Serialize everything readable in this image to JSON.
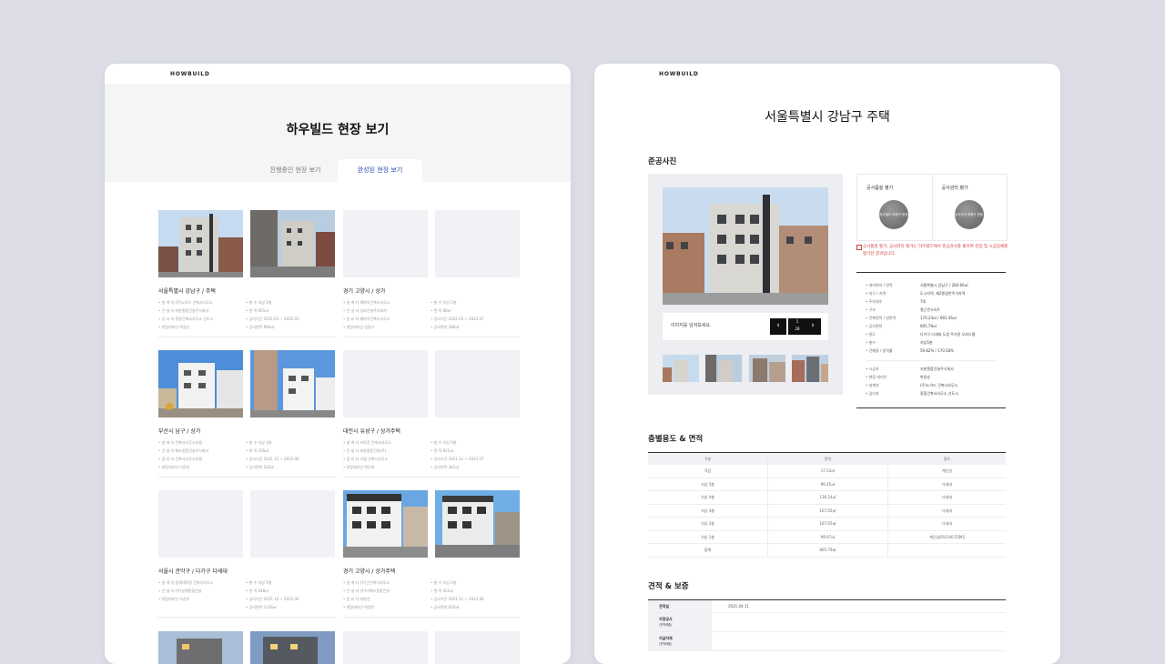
{
  "left": {
    "logo": "HOWBUILD",
    "title": "하우빌드 현장 보기",
    "tabs": [
      {
        "label": "진행중인 현장 보기",
        "active": false
      },
      {
        "label": "완성된 현장 보기",
        "active": true
      }
    ],
    "cards": [
      {
        "title": "서울특별시 강남구 / 주택",
        "rows": [
          "• 설 계 자  (주)노아드 건축사사무소",
          "• 건 설 사  지한종합건설주식회사",
          "• 공 사 자  종합건축사사무소 선도시",
          "• 현장대리인  박용순",
          "• 층    수  지상 5층",
          "• 면    적  665㎡",
          "• 공사기간  2021.03 ~ 2022.03",
          "• 공사면적  896㎡"
        ]
      },
      {
        "title": "경기 고양시 / 상가",
        "rows": [
          "• 설 계 자  해마이건축사사무소",
          "• 건 설 사  성보건설주식회사",
          "• 감 리 자  해마이건축사사무소",
          "• 현장대리인  김창규",
          "• 층    수  지상 5층",
          "• 면    적  88㎡",
          "• 공사기간  2022.03 ~ 2022.07",
          "• 공사면적  286㎡"
        ]
      },
      {
        "title": "부산시 남구 / 상가",
        "rows": [
          "• 설 계 자  건축사사무소유엠",
          "• 건 설 사  해조종합건설주식회사",
          "• 감 리 자  건축사사무소유엠",
          "• 현장대리인  이운호",
          "• 층    수  지상 3층",
          "• 면    적  205㎡",
          "• 공사기간  2021.12 ~ 2022.06",
          "• 공사면적  220㎡"
        ]
      },
      {
        "title": "대전시 유성구 / 상가주택",
        "rows": [
          "• 설 계 자  하로건 건축사사무소",
          "• 건 설 사  세한종합건설(주)",
          "• 감 리 자  디엠 건축사사무소",
          "• 현장대리인  박진희",
          "• 층    수  지상 5층",
          "• 면    적  821㎡",
          "• 공사기간  2021.11 ~ 2022.07",
          "• 공사면적  381㎡"
        ]
      },
      {
        "title": "서울시 관악구 / 다가구 다세대",
        "rows": [
          "• 설 계 자  동해대학원 건축사사무소",
          "• 건 설 사  (주)일해종합건설",
          "• 현장대리인  차성우",
          "• 층    수  지상 5층",
          "• 면    적  448㎡",
          "• 공사기간  2021.10 ~ 2022.06",
          "• 공사면적  1136㎡"
        ]
      },
      {
        "title": "경기 고양시 / 상가주택",
        "rows": [
          "• 설 계 자  (주)근건축사사무소",
          "• 건 설 사  (주)이메스종합건설",
          "• 감 리 자  대원건",
          "• 현장대리인  박정빈",
          "• 층    수  지상 5층",
          "• 면    적  351㎡",
          "• 공사기간  2021.11 ~ 2022.06",
          "• 공사면적  820㎡"
        ]
      }
    ]
  },
  "right": {
    "logo": "HOWBUILD",
    "title": "서울특별시 강남구 주택",
    "photo_section": "준공사진",
    "photo_hint": "이미지를 넘겨보세요.",
    "pager": {
      "current": "1",
      "total": "28"
    },
    "eval": [
      {
        "label": "공사품질 평가",
        "badge": "하우빌드 미평가 현장"
      },
      {
        "label": "공사관리 평가",
        "badge": "공사관리 미평가 현장"
      }
    ],
    "notice": "공사품질 평가, 공사관리 평가는 하우빌드에서 준공검사를 통하여 현장 및 시공업체를 평가한 결과입니다.",
    "spec_top": [
      [
        "• 대지위치 / 면적",
        "서울특별시 강남구 / 284.60㎡"
      ],
      [
        "• 지구 / 지역",
        "도시지역, 제2종일반주거지역"
      ],
      [
        "• 주차대수",
        "7대"
      ],
      [
        "• 구조",
        "철근콘크리트"
      ],
      [
        "• 건축면적 / 연면적",
        "170.24㎡ / 665.46㎡"
      ],
      [
        "• 공사면적",
        "665.79㎡"
      ],
      [
        "• 용도",
        "다가구 다세대 도생 주거용 오피스텔"
      ],
      [
        "• 층수",
        "지상5층"
      ],
      [
        "• 건폐율 / 용적률",
        "59.82% / 170.58%"
      ]
    ],
    "spec_bottom": [
      [
        "• 시공자",
        "지한종합건설주식회사"
      ],
      [
        "• 현장 대리인",
        "박용순"
      ],
      [
        "• 설계자",
        "(주)노아드 건축사사무소"
      ],
      [
        "• 감리자",
        "종합건축사사무소 선도시"
      ]
    ],
    "floor_section": "층별용도 & 면적",
    "floor_headers": [
      "구분",
      "면적",
      "용도"
    ],
    "floors": [
      [
        "옥탑",
        "17.53㎡",
        "계단실"
      ],
      [
        "지상 5층",
        "96.45㎡",
        "다세대"
      ],
      [
        "지상 4층",
        "136.14㎡",
        "다세대"
      ],
      [
        "지상 3층",
        "167.05㎡",
        "다세대"
      ],
      [
        "지상 2층",
        "167.05㎡",
        "다세대"
      ],
      [
        "지상 1층",
        "99.97㎡",
        "계단실/EV/140.55M2"
      ],
      [
        "합계",
        "665.79㎡",
        ""
      ]
    ],
    "estimate_section": "견적 & 보증",
    "estimate": [
      {
        "key": "견적일",
        "sub": "",
        "value": "2021.04.11"
      },
      {
        "key": "지명공사",
        "sub": "(견적제출)",
        "value": ""
      },
      {
        "key": "지급자재",
        "sub": "(견적제출)",
        "value": ""
      }
    ]
  }
}
